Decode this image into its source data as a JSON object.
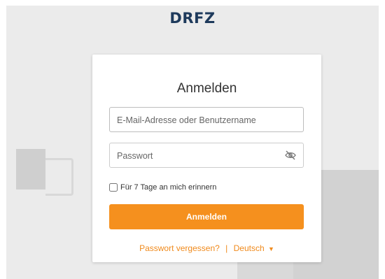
{
  "brand": {
    "logo_text": "DRFZ"
  },
  "login": {
    "title": "Anmelden",
    "email_placeholder": "E-Mail-Adresse oder Benutzername",
    "password_placeholder": "Passwort",
    "remember_label": "Für 7 Tage an mich erinnern",
    "remember_checked": false,
    "submit_label": "Anmelden",
    "forgot_label": "Passwort vergessen?",
    "separator": "|",
    "language_label": "Deutsch",
    "language_caret": "▼"
  },
  "icons": {
    "password_toggle": "eye-slash-icon",
    "language_dropdown": "caret-down-icon"
  },
  "colors": {
    "accent": "#f5901e",
    "link": "#f08a1c",
    "logo": "#1e3a5c",
    "logo_accent": "#1aa3b8",
    "background": "#ebebeb"
  }
}
